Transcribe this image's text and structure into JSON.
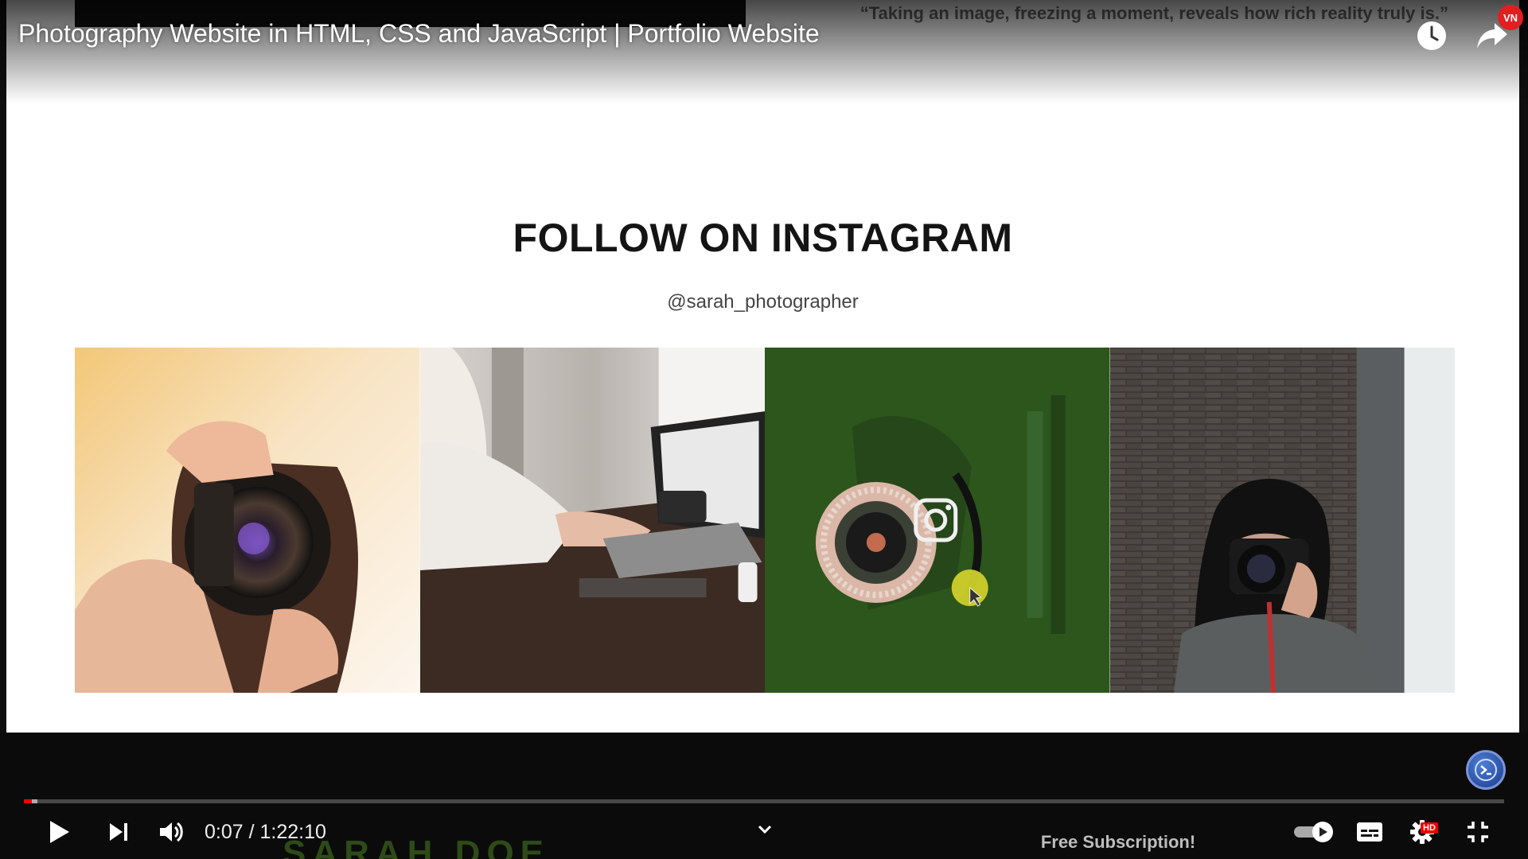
{
  "video": {
    "title": "Photography Website in HTML, CSS and JavaScript | Portfolio Website"
  },
  "top_bar": {
    "watch_later_icon": "clock-icon",
    "share_icon": "share-arrow-icon",
    "badge_text": "VN"
  },
  "frame": {
    "quote": "“Taking an image, freezing a moment, reveals how rich reality truly is.”",
    "heading": "FOLLOW ON INSTAGRAM",
    "handle": "@sarah_photographer",
    "watermark": "SARAH DOE",
    "promo": "Free Subscription!",
    "photos": [
      "photographer-closeup",
      "laptop-desk",
      "instagram-ring-light",
      "woman-camera-brick-wall"
    ]
  },
  "player": {
    "current_time": "0:07",
    "separator": " / ",
    "duration": "1:22:10",
    "progress_fraction": 0.0054,
    "loaded_fraction": 0.009,
    "hd_badge": "HD",
    "accent": "#ff0000"
  }
}
